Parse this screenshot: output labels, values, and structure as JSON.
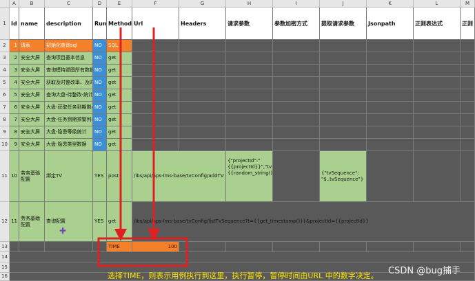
{
  "columns": [
    "A",
    "B",
    "C",
    "D",
    "E",
    "F",
    "G",
    "H",
    "I",
    "J",
    "K",
    "L",
    "M"
  ],
  "row_numbers": [
    "1",
    "2",
    "3",
    "4",
    "5",
    "6",
    "7",
    "8",
    "9",
    "10",
    "11",
    "12",
    "13",
    "14",
    "15",
    "16"
  ],
  "headers": [
    "Id",
    "name",
    "description",
    "Run",
    "Method",
    "Url",
    "Headers",
    "请求参数",
    "参数加密方式",
    "提取请求参数",
    "Jsonpath",
    "正则表达式",
    "正则"
  ],
  "rows": [
    {
      "id": "1",
      "name": "请表",
      "description": "初始化查询sql",
      "run": "NO",
      "method": "SQL"
    },
    {
      "id": "2",
      "name": "安全大屏",
      "description": "查询项目基本信息",
      "run": "NO",
      "method": "get"
    },
    {
      "id": "3",
      "name": "安全大屏",
      "description": "查询模特颁图所有数据",
      "run": "NO",
      "method": "get"
    },
    {
      "id": "4",
      "name": "安全大屏",
      "description": "获取及时整改率、及时",
      "run": "NO",
      "method": "get"
    },
    {
      "id": "5",
      "name": "安全大屏",
      "description": "查询大盘-待整改-统计",
      "run": "NO",
      "method": "get"
    },
    {
      "id": "6",
      "name": "安全大屏",
      "description": "大盘-获取任务到期剩余",
      "run": "NO",
      "method": "get"
    },
    {
      "id": "7",
      "name": "安全大屏",
      "description": "大盘-任务到期预警列表",
      "run": "NO",
      "method": "get"
    },
    {
      "id": "8",
      "name": "安全大屏",
      "description": "大盘-隐患等级统计",
      "run": "NO",
      "method": "get"
    },
    {
      "id": "9",
      "name": "安全大屏",
      "description": "大盘-隐患类型数据",
      "run": "NO",
      "method": "get"
    },
    {
      "id": "10",
      "name": "劳务基础配置",
      "description": "绑定TV",
      "run": "YES",
      "method": "post",
      "url": "/ibs/api/aps-lms-base/tvConfig/addTV",
      "request_params": "{\"projectId\":\"{{projectId}}\",\"tvSequence\":\"{{random_string()}}\"}",
      "extract_params": "{\"tvSequence\": \"$..tvSequence\"}"
    },
    {
      "id": "11",
      "name": "劳务基础配置",
      "description": "查询配置",
      "run": "YES",
      "method": "get",
      "url": "/ibs/api/aps-lms-base/tvConfig/listTvSequence?t={{get_timestamp()}}&projectId={{projectId}}"
    },
    {
      "method": "TIME",
      "url": "100"
    }
  ],
  "annotation": "选择TIME，则表示用例执行到这里，执行暂停，暂停时间由URL 中的数字决定。",
  "watermark": "CSDN @bug捕手",
  "colors": {
    "green": "#a9d08e",
    "blue": "#3a8fd6",
    "orange": "#f4812a",
    "gray": "#595959",
    "arrow_red": "#e02020",
    "caption_yellow": "#ffe600"
  }
}
